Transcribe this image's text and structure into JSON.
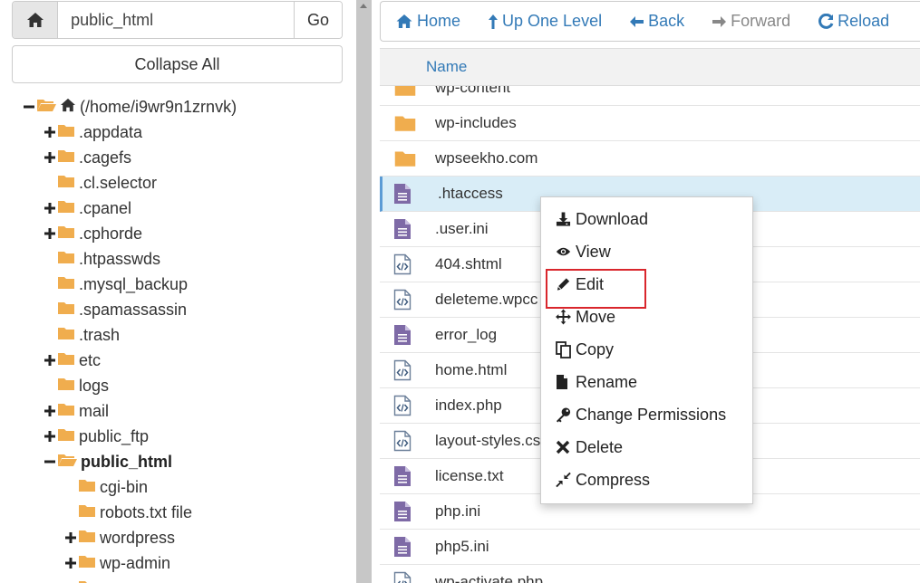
{
  "left": {
    "path_value": "public_html",
    "go_label": "Go",
    "collapse_label": "Collapse All",
    "tree": [
      {
        "label": "(/home/i9wr9n1zrnvk)",
        "toggle": "minus",
        "indent": 0,
        "home": true,
        "open": true,
        "bold": false
      },
      {
        "label": ".appdata",
        "toggle": "plus",
        "indent": 1,
        "bold": false
      },
      {
        "label": ".cagefs",
        "toggle": "plus",
        "indent": 1,
        "bold": false
      },
      {
        "label": ".cl.selector",
        "toggle": "none",
        "indent": 1,
        "bold": false
      },
      {
        "label": ".cpanel",
        "toggle": "plus",
        "indent": 1,
        "bold": false
      },
      {
        "label": ".cphorde",
        "toggle": "plus",
        "indent": 1,
        "bold": false
      },
      {
        "label": ".htpasswds",
        "toggle": "none",
        "indent": 1,
        "bold": false
      },
      {
        "label": ".mysql_backup",
        "toggle": "none",
        "indent": 1,
        "bold": false
      },
      {
        "label": ".spamassassin",
        "toggle": "none",
        "indent": 1,
        "bold": false
      },
      {
        "label": ".trash",
        "toggle": "none",
        "indent": 1,
        "bold": false
      },
      {
        "label": "etc",
        "toggle": "plus",
        "indent": 1,
        "bold": false
      },
      {
        "label": "logs",
        "toggle": "none",
        "indent": 1,
        "bold": false
      },
      {
        "label": "mail",
        "toggle": "plus",
        "indent": 1,
        "bold": false
      },
      {
        "label": "public_ftp",
        "toggle": "plus",
        "indent": 1,
        "bold": false
      },
      {
        "label": "public_html",
        "toggle": "minus",
        "indent": 1,
        "open": true,
        "bold": true
      },
      {
        "label": "cgi-bin",
        "toggle": "none",
        "indent": 2,
        "bold": false
      },
      {
        "label": "robots.txt file",
        "toggle": "none",
        "indent": 2,
        "bold": false
      },
      {
        "label": "wordpress",
        "toggle": "plus",
        "indent": 2,
        "bold": false
      },
      {
        "label": "wp-admin",
        "toggle": "plus",
        "indent": 2,
        "bold": false
      },
      {
        "label": "",
        "toggle": "plus",
        "indent": 2,
        "bold": false
      }
    ]
  },
  "toolbar": {
    "home": "Home",
    "up": "Up One Level",
    "back": "Back",
    "forward": "Forward",
    "reload": "Reload"
  },
  "table": {
    "name_header": "Name",
    "rows": [
      {
        "name": "wp-content",
        "type": "folder"
      },
      {
        "name": "wp-includes",
        "type": "folder"
      },
      {
        "name": "wpseekho.com",
        "type": "folder"
      },
      {
        "name": ".htaccess",
        "type": "text",
        "selected": true
      },
      {
        "name": ".user.ini",
        "type": "text"
      },
      {
        "name": "404.shtml",
        "type": "code"
      },
      {
        "name": "deleteme.wpcc",
        "type": "code"
      },
      {
        "name": "error_log",
        "type": "text"
      },
      {
        "name": "home.html",
        "type": "code"
      },
      {
        "name": "index.php",
        "type": "code"
      },
      {
        "name": "layout-styles.cs",
        "type": "code"
      },
      {
        "name": "license.txt",
        "type": "text"
      },
      {
        "name": "php.ini",
        "type": "text"
      },
      {
        "name": "php5.ini",
        "type": "text"
      },
      {
        "name": "wp-activate.php",
        "type": "code"
      }
    ]
  },
  "context_menu": {
    "items": [
      {
        "label": "Download",
        "icon": "download-icon"
      },
      {
        "label": "View",
        "icon": "eye-icon"
      },
      {
        "label": "Edit",
        "icon": "pencil-icon",
        "highlight": true
      },
      {
        "label": "Move",
        "icon": "move-icon"
      },
      {
        "label": "Copy",
        "icon": "copy-icon"
      },
      {
        "label": "Rename",
        "icon": "file-icon"
      },
      {
        "label": "Change Permissions",
        "icon": "key-icon"
      },
      {
        "label": "Delete",
        "icon": "times-icon"
      },
      {
        "label": "Compress",
        "icon": "compress-icon"
      }
    ]
  },
  "colors": {
    "link": "#337ab7",
    "folder": "#f0ad4e",
    "file": "#7e6aa6",
    "selected_row": "#d9edf7",
    "highlight_border": "#d9262c"
  }
}
